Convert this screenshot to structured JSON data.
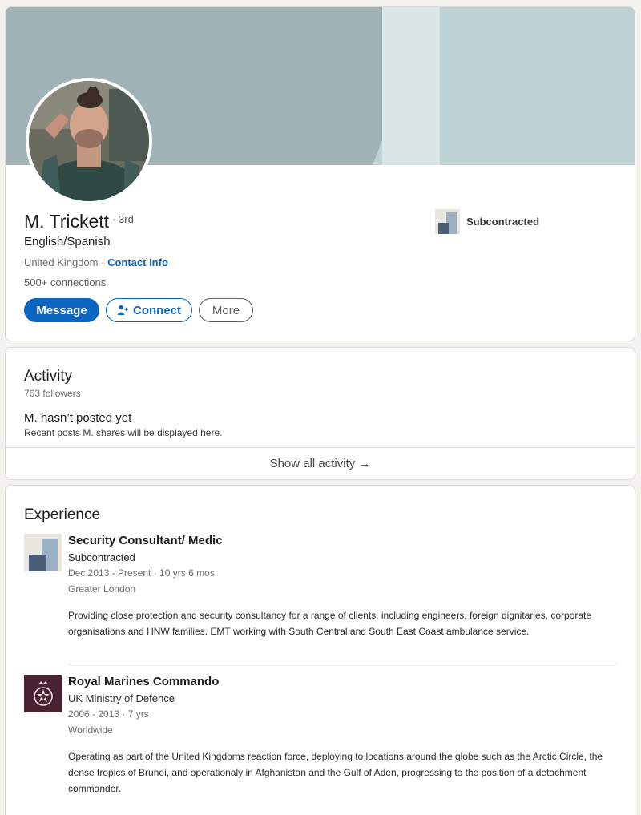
{
  "profile": {
    "name": "M. Trickett",
    "degree": "· 3rd",
    "headline": "English/Spanish",
    "location": "United Kingdom",
    "separator": " · ",
    "contact_info": "Contact info",
    "connections": "500+ connections",
    "current_company": "Subcontracted",
    "buttons": {
      "message": "Message",
      "connect": "Connect",
      "more": "More"
    }
  },
  "activity": {
    "title": "Activity",
    "followers": "763 followers",
    "empty_title": "M. hasn’t posted yet",
    "empty_subtitle": "Recent posts M. shares will be displayed here.",
    "show_all": "Show all activity →"
  },
  "experience": {
    "title": "Experience",
    "items": [
      {
        "title": "Security Consultant/ Medic",
        "company": "Subcontracted",
        "dates": "Dec 2013 - Present · 10 yrs 6 mos",
        "location": "Greater London",
        "description": "Providing close protection and security consultancy for a range of clients, including engineers, foreign dignitaries, corporate organisations and HNW families. EMT working with South Central and South East Coast ambulance service.",
        "logo_icon": "company-placeholder-icon"
      },
      {
        "title": "Royal Marines Commando",
        "company": "UK Ministry of Defence",
        "dates": "2006 - 2013 · 7 yrs",
        "location": "Worldwide",
        "description": "Operating as part of the United Kingdoms reaction force, deploying to locations around the globe such as the Arctic Circle, the dense tropics of Brunei, and operationaly in Afghanistan and the Gulf of Aden, progressing to the position of a detachment commander.",
        "logo_icon": "mod-crest-icon"
      }
    ]
  },
  "colors": {
    "accent": "#0a66c2",
    "banner": "#bfd2d6",
    "banner_arc": "#a1b3b6",
    "mod_logo": "#4a2232"
  }
}
